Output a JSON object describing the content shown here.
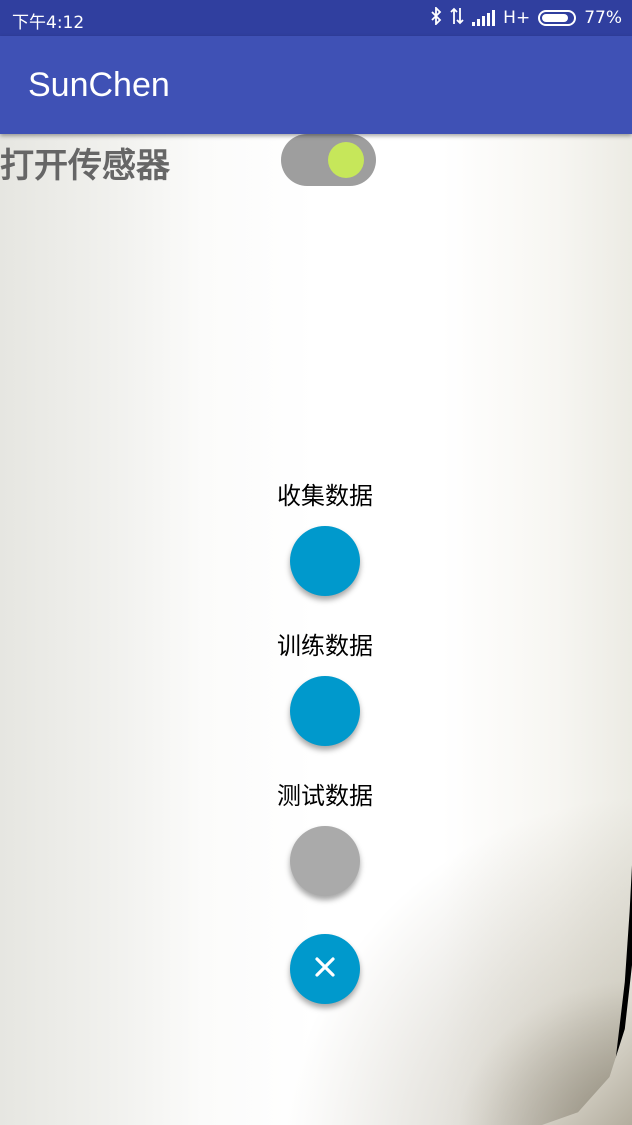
{
  "status_bar": {
    "time": "下午4:12",
    "network": "H+",
    "battery_percent": "77%",
    "icons": [
      "bluetooth-icon",
      "data-transfer-icon",
      "signal-icon",
      "battery-icon"
    ]
  },
  "app_bar": {
    "title": "SunChen"
  },
  "sensor": {
    "label": "打开传感器",
    "switch_on": true
  },
  "fab_menu": {
    "items": [
      {
        "label": "收集数据",
        "color": "#0099CC"
      },
      {
        "label": "训练数据",
        "color": "#0099CC"
      },
      {
        "label": "测试数据",
        "color": "#AAAAAA"
      }
    ],
    "close": {
      "icon": "close-icon",
      "color": "#0099CC"
    }
  },
  "colors": {
    "status_bar": "#303F9F",
    "app_bar": "#3F51B5",
    "switch_thumb": "#C6E75A",
    "switch_track": "#9E9E9E"
  }
}
